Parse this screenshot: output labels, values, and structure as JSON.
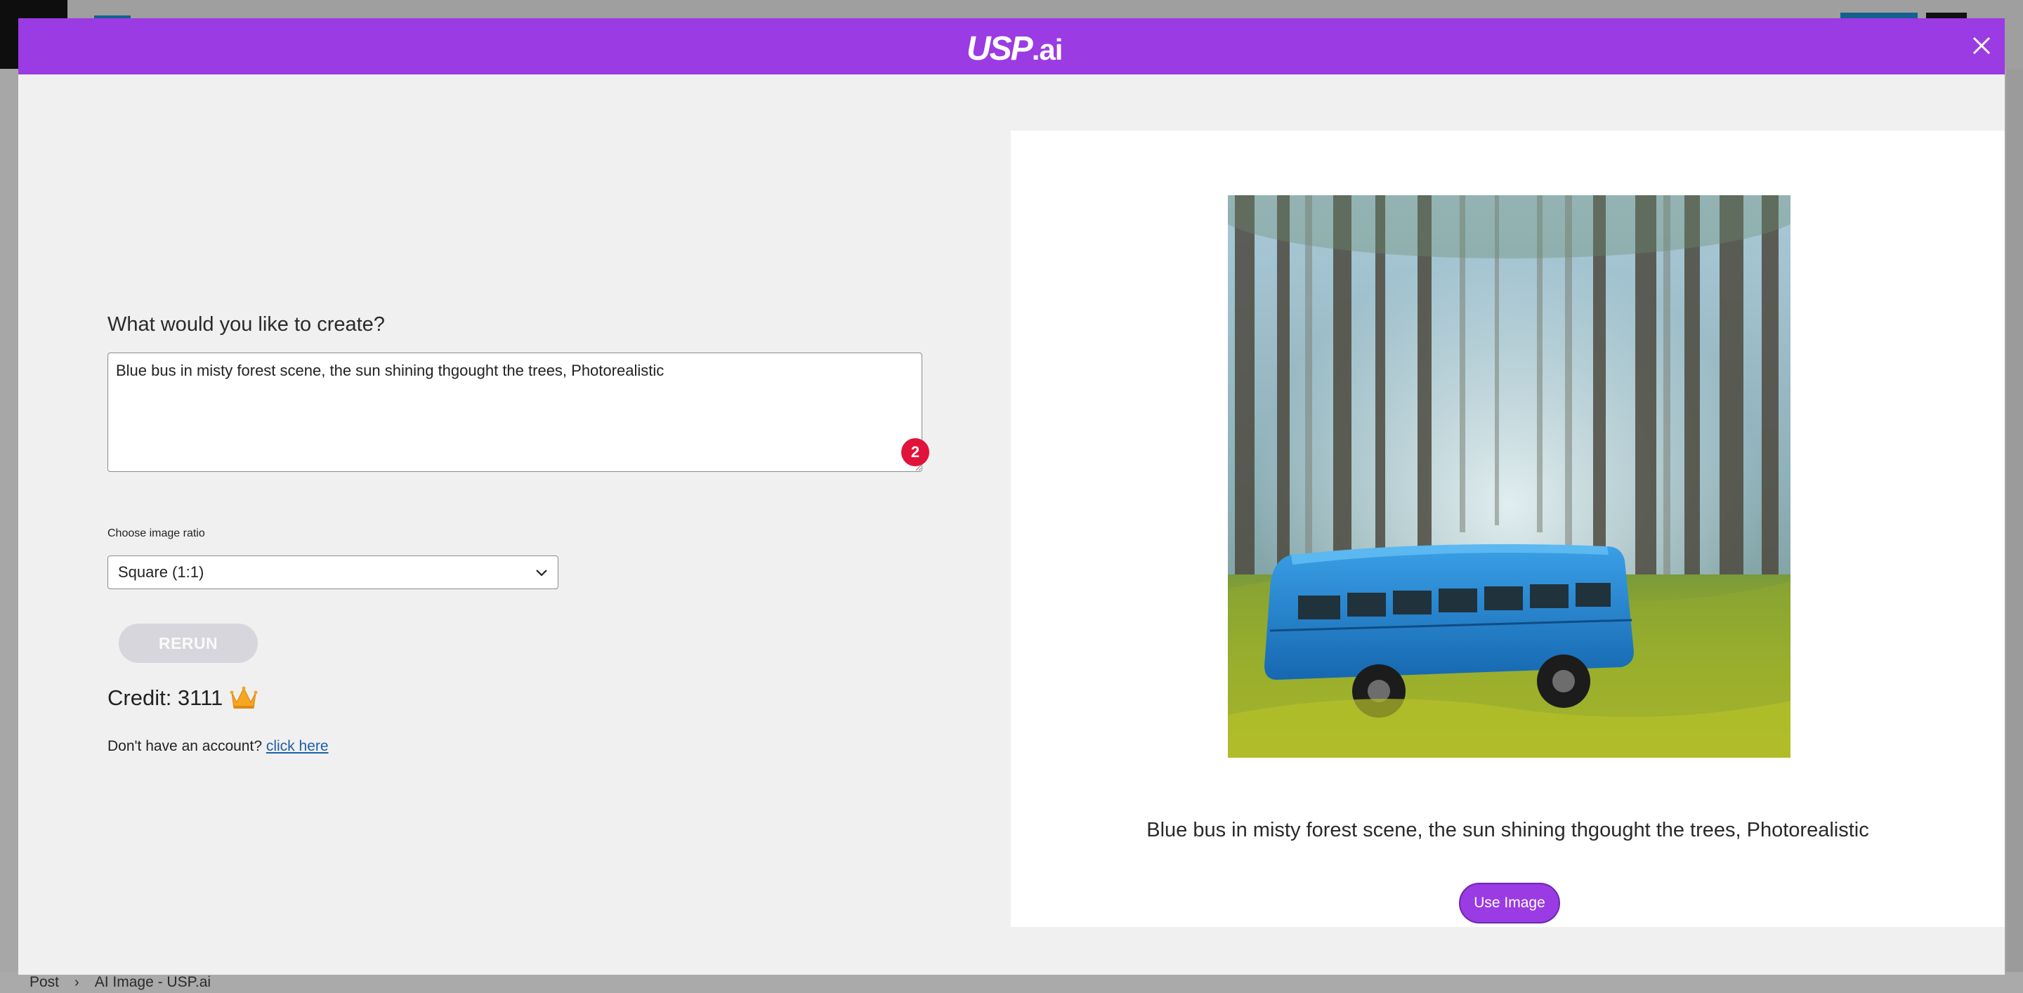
{
  "modal": {
    "logo_brand": "USP",
    "logo_tld": ".ai",
    "close_icon": "close-icon"
  },
  "form": {
    "question": "What would you like to create?",
    "prompt_value": "Blue bus in misty forest scene, the sun shining thgought the trees, Photorealistic",
    "badge_count": "2",
    "ratio_label": "Choose image ratio",
    "ratio_selected": "Square (1:1)",
    "rerun_label": "RERUN",
    "credit_label": "Credit: 3111",
    "crown_icon": "crown-icon",
    "account_prompt": "Don't have an account?",
    "account_link": "click here"
  },
  "result": {
    "caption": "Blue bus in misty forest scene, the sun shining thgought the trees, Photorealistic",
    "use_label": "Use Image"
  },
  "footer": {
    "breadcrumb": [
      "Post",
      "AI Image - USP.ai"
    ]
  },
  "colors": {
    "header_purple": "#9b3be3",
    "badge_red": "#e2133a",
    "link_blue": "#1e5fa8",
    "bus_blue": "#1f7fc8"
  }
}
